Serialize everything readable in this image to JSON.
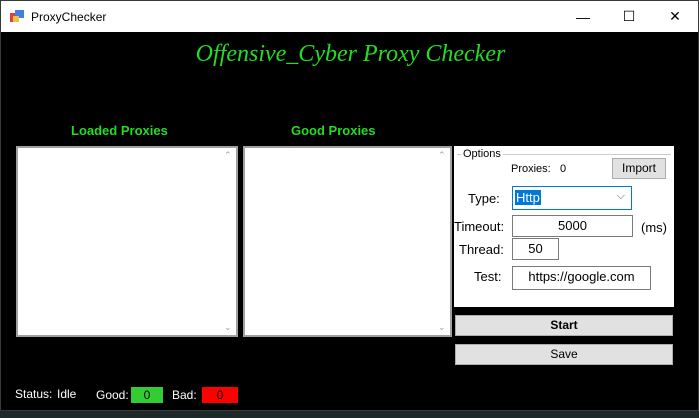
{
  "window": {
    "title": "ProxyChecker",
    "minimize": "—",
    "maximize": "☐",
    "close": "✕"
  },
  "heading": "Offensive_Cyber Proxy Checker",
  "lists": {
    "loaded_label": "Loaded Proxies",
    "good_label": "Good Proxies"
  },
  "options": {
    "legend": "Options",
    "proxies_label": "Proxies:",
    "proxies_count": "0",
    "import": "Import",
    "type_label": "Type:",
    "type_value": "Http",
    "timeout_label": "Timeout:",
    "timeout_value": "5000",
    "timeout_unit": "(ms)",
    "thread_label": "Thread:",
    "thread_value": "50",
    "test_label": "Test:",
    "test_value": "https://google.com"
  },
  "buttons": {
    "start": "Start",
    "save": "Save"
  },
  "status": {
    "label": "Status:",
    "value": "Idle",
    "good_label": "Good:",
    "good_count": "0",
    "bad_label": "Bad:",
    "bad_count": "0",
    "good_color": "#33cc33",
    "bad_color": "#ff0000"
  }
}
